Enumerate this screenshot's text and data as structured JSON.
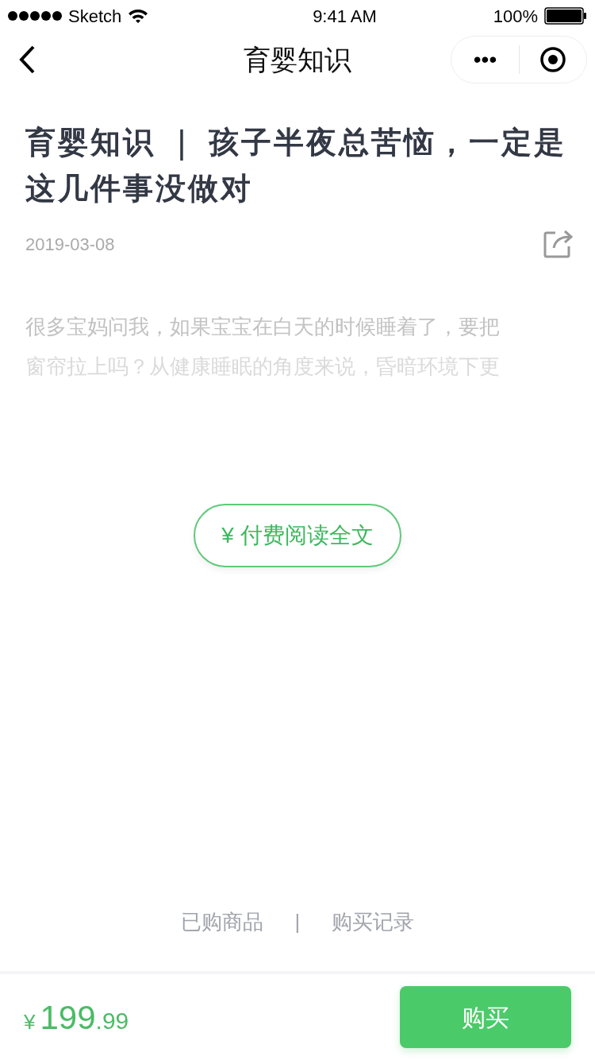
{
  "status_bar": {
    "carrier": "Sketch",
    "time": "9:41 AM",
    "battery": "100%"
  },
  "nav": {
    "title": "育婴知识",
    "more": "•••"
  },
  "article": {
    "title": "育婴知识 ｜ 孩子半夜总苦恼，一定是这几件事没做对",
    "date": "2019-03-08",
    "preview_lines": [
      "很多宝妈问我，如果宝宝在白天的时候睡着了，要把",
      "窗帘拉上吗？从健康睡眠的角度来说，昏暗环境下更"
    ]
  },
  "pay_button": "¥ 付费阅读全文",
  "links": [
    "已购商品",
    "购买记录"
  ],
  "link_separator": "|",
  "bottom_bar": {
    "currency": "¥",
    "price_main": "199",
    "price_decimal": ".99",
    "buy": "购买"
  }
}
